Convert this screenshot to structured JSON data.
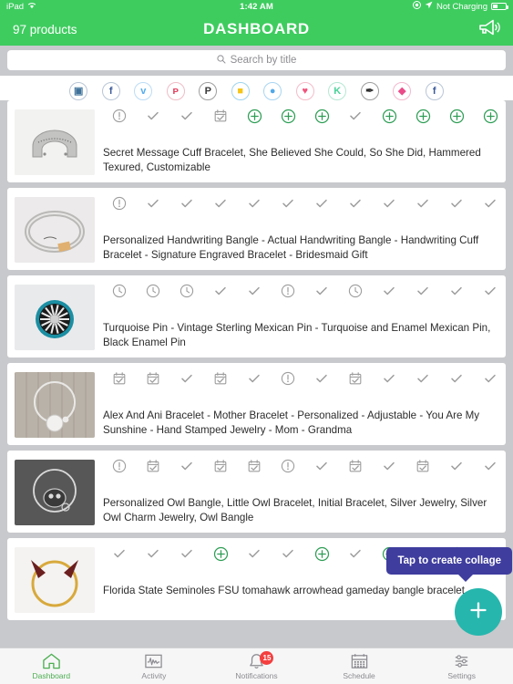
{
  "status_bar": {
    "device": "iPad",
    "wifi_icon": "wifi-icon",
    "time": "1:42 AM",
    "location_icon": "location-arrow-icon",
    "lock_icon": "rotation-lock-icon",
    "battery_text": "Not Charging"
  },
  "nav": {
    "product_count": "97 products",
    "title": "DASHBOARD",
    "announce_icon": "megaphone-icon"
  },
  "search": {
    "placeholder": "Search by title",
    "icon": "search-icon",
    "value": ""
  },
  "social_icons": [
    {
      "name": "instagram-icon",
      "glyph": "▣",
      "color": "#3f729b",
      "border": "#b9c6d6"
    },
    {
      "name": "facebook-icon",
      "glyph": "f",
      "color": "#3b5998",
      "border": "#b9c6d6"
    },
    {
      "name": "twitter-icon",
      "glyph": "ᴠ",
      "color": "#55acee",
      "border": "#bcdcf5"
    },
    {
      "name": "pinterest-icon",
      "glyph": "ᴘ",
      "color": "#e4405f",
      "border": "#f0bcc6"
    },
    {
      "name": "polyvore-icon",
      "glyph": "P",
      "color": "#3a3a3a",
      "border": "#9e9e9e"
    },
    {
      "name": "flipboard-icon",
      "glyph": "■",
      "color": "#f5c518",
      "border": "#9fd4ef"
    },
    {
      "name": "plurk-icon",
      "glyph": "●",
      "color": "#51a9e8",
      "border": "#a8d5f2"
    },
    {
      "name": "wanelo-icon",
      "glyph": "♥",
      "color": "#f0547c",
      "border": "#f5bcc9"
    },
    {
      "name": "kaboodle-icon",
      "glyph": "K",
      "color": "#4cd39a",
      "border": "#b5e8d3"
    },
    {
      "name": "tumblr-icon",
      "glyph": "✒",
      "color": "#2c2c2c",
      "border": "#9e9e9e"
    },
    {
      "name": "dribbble-icon",
      "glyph": "◆",
      "color": "#ea4c89",
      "border": "#f4b8ce"
    },
    {
      "name": "facebook-page-icon",
      "glyph": "f",
      "color": "#3b5998",
      "border": "#b9c6d6"
    }
  ],
  "products": [
    {
      "title": "Secret Message Cuff Bracelet, She Believed She Could, So She Did, Hammered Texured, Customizable",
      "thumb": "silver-cuff-bracelet",
      "statuses": [
        "warning",
        "check",
        "check",
        "calendar",
        "plus",
        "plus",
        "plus",
        "check",
        "plus",
        "plus",
        "plus",
        "plus"
      ]
    },
    {
      "title": "Personalized Handwriting Bangle - Actual Handwriting Bangle - Handwriting Cuff Bracelet - Signature Engraved Bracelet - Bridesmaid Gift",
      "thumb": "handwriting-bangle",
      "statuses": [
        "warning",
        "check",
        "check",
        "check",
        "check",
        "check",
        "check",
        "check",
        "check",
        "check",
        "check",
        "check"
      ]
    },
    {
      "title": "Turquoise Pin - Vintage Sterling Mexican Pin - Turquoise and Enamel Mexican Pin, Black Enamel Pin",
      "thumb": "turquoise-pin",
      "statuses": [
        "clock",
        "clock",
        "clock",
        "check",
        "check",
        "warning",
        "check",
        "clock",
        "check",
        "check",
        "check",
        "check"
      ]
    },
    {
      "title": "Alex And Ani Bracelet - Mother Bracelet - Personalized - Adjustable - You Are My Sunshine - Hand Stamped Jewelry - Mom - Grandma",
      "thumb": "alex-ani-bracelet",
      "statuses": [
        "calendar",
        "calendar",
        "check",
        "calendar",
        "check",
        "warning",
        "check",
        "calendar",
        "check",
        "check",
        "check",
        "check"
      ]
    },
    {
      "title": "Personalized Owl Bangle, Little Owl Bracelet, Initial Bracelet, Silver Jewelry, Silver Owl Charm Jewelry, Owl Bangle",
      "thumb": "owl-bangle",
      "statuses": [
        "warning",
        "calendar",
        "check",
        "calendar",
        "calendar",
        "warning",
        "check",
        "calendar",
        "check",
        "calendar",
        "check",
        "check"
      ]
    },
    {
      "title": "Florida State Seminoles FSU tomahawk arrowhead gameday bangle bracelet",
      "thumb": "fsu-bangle",
      "statuses": [
        "check",
        "check",
        "check",
        "plus",
        "check",
        "check",
        "plus",
        "check",
        "plus",
        "check",
        "plus",
        "plus"
      ]
    }
  ],
  "tooltip": {
    "text": "Tap to create collage",
    "color": "#3f3d9e"
  },
  "fab": {
    "icon": "plus-icon",
    "color": "#26b6ad"
  },
  "tabs": [
    {
      "label": "Dashboard",
      "icon": "home-icon",
      "active": true,
      "badge": ""
    },
    {
      "label": "Activity",
      "icon": "activity-icon",
      "active": false,
      "badge": ""
    },
    {
      "label": "Notifications",
      "icon": "bell-icon",
      "active": false,
      "badge": "15"
    },
    {
      "label": "Schedule",
      "icon": "calendar-icon",
      "active": false,
      "badge": ""
    },
    {
      "label": "Settings",
      "icon": "sliders-icon",
      "active": false,
      "badge": ""
    }
  ]
}
